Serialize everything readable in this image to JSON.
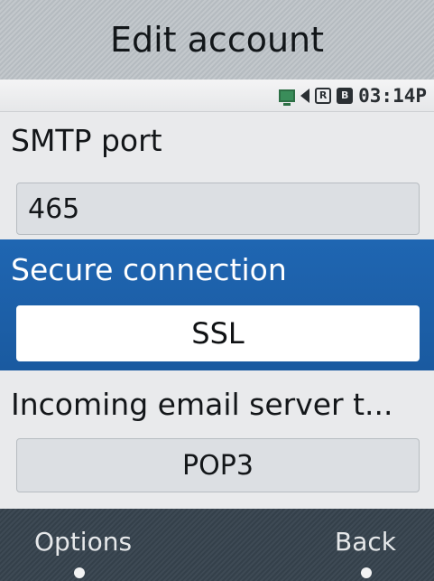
{
  "header": {
    "title": "Edit account"
  },
  "status": {
    "time": "03:14P",
    "icons": [
      "network-icon",
      "speaker-icon",
      "roaming-icon",
      "battery-icon"
    ],
    "roaming_glyph": "R",
    "bluetooth_glyph": "B"
  },
  "form": {
    "smtp_port": {
      "label": "SMTP port",
      "value": "465"
    },
    "secure_connection": {
      "label": "Secure connection",
      "value": "SSL"
    },
    "incoming_server_type": {
      "label": "Incoming email server t...",
      "value": "POP3"
    }
  },
  "softkeys": {
    "left": "Options",
    "right": "Back"
  },
  "colors": {
    "selection": "#1f66b2",
    "softbar": "#3a4651",
    "titlebar": "#bdc2c6"
  }
}
